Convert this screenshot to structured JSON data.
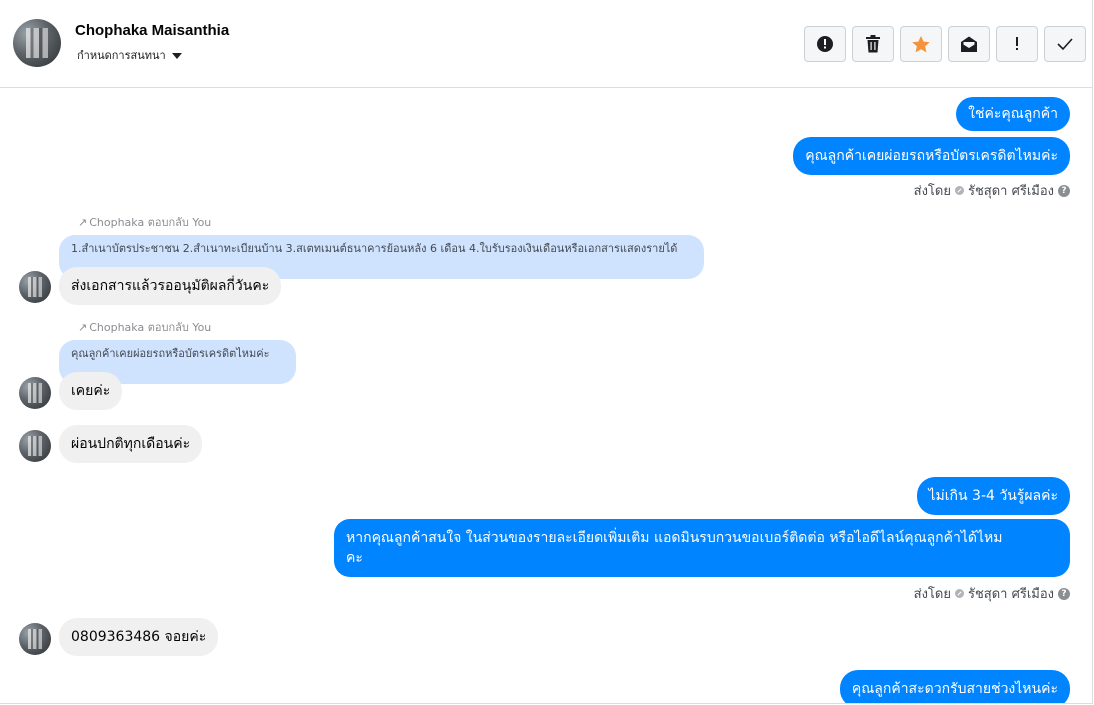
{
  "header": {
    "contact_name": "Chophaka Maisanthia",
    "assign_label": "กำหนดการสนทนา"
  },
  "toolbar": {
    "mark_spam_icon": "exclamation-circle-icon",
    "delete_icon": "trash-icon",
    "star_icon": "star-icon",
    "mark_unread_icon": "envelope-icon",
    "important_icon": "exclamation-icon",
    "done_icon": "check-icon",
    "star_color": "#f7923b"
  },
  "messages": {
    "m1": "ใช่ค่ะคุณลูกค้า",
    "m2": "คุณลูกค้าเคยผ่อยรถหรือบัตรเครดิตไหมค่ะ",
    "sent1_prefix": "ส่งโดย",
    "sent1_name": "รัชสุดา ศรีเมือง",
    "reply1_note": "Chophaka ตอบกลับ You",
    "quote1": "1.สำเนาบัตรประชาชน 2.สำเนาทะเบียนบ้าน 3.สเตทเมนต์ธนาคารย้อนหลัง 6 เดือน 4.ใบรับรองเงินเดือนหรือเอกสารแสดงรายได้",
    "m3": "ส่งเอกสารแล้วรออนุมัติผลกี่วันคะ",
    "reply2_note": "Chophaka ตอบกลับ You",
    "quote2": "คุณลูกค้าเคยผ่อยรถหรือบัตรเครดิตไหมค่ะ",
    "m4": "เคยค่ะ",
    "m5": "ผ่อนปกติทุกเดือนค่ะ",
    "m6": "ไม่เกิน 3-4 วันรู้ผลค่ะ",
    "m7_line1": "หากคุณลูกค้าสนใจ ในส่วนของรายละเอียดเพิ่มเติม แอดมินรบกวนขอเบอร์ติดต่อ หรือไอดีไลน์คุณลูกค้าได้ไหม",
    "m7_line2": "คะ",
    "sent2_prefix": "ส่งโดย",
    "sent2_name": "รัชสุดา ศรีเมือง",
    "m8": "0809363486 จอยค่ะ",
    "m9": "คุณลูกค้าสะดวกรับสายช่วงไหนค่ะ"
  },
  "colors": {
    "outgoing": "#0084ff",
    "incoming": "#f0f0f0",
    "quoted": "#cfe3ff"
  }
}
